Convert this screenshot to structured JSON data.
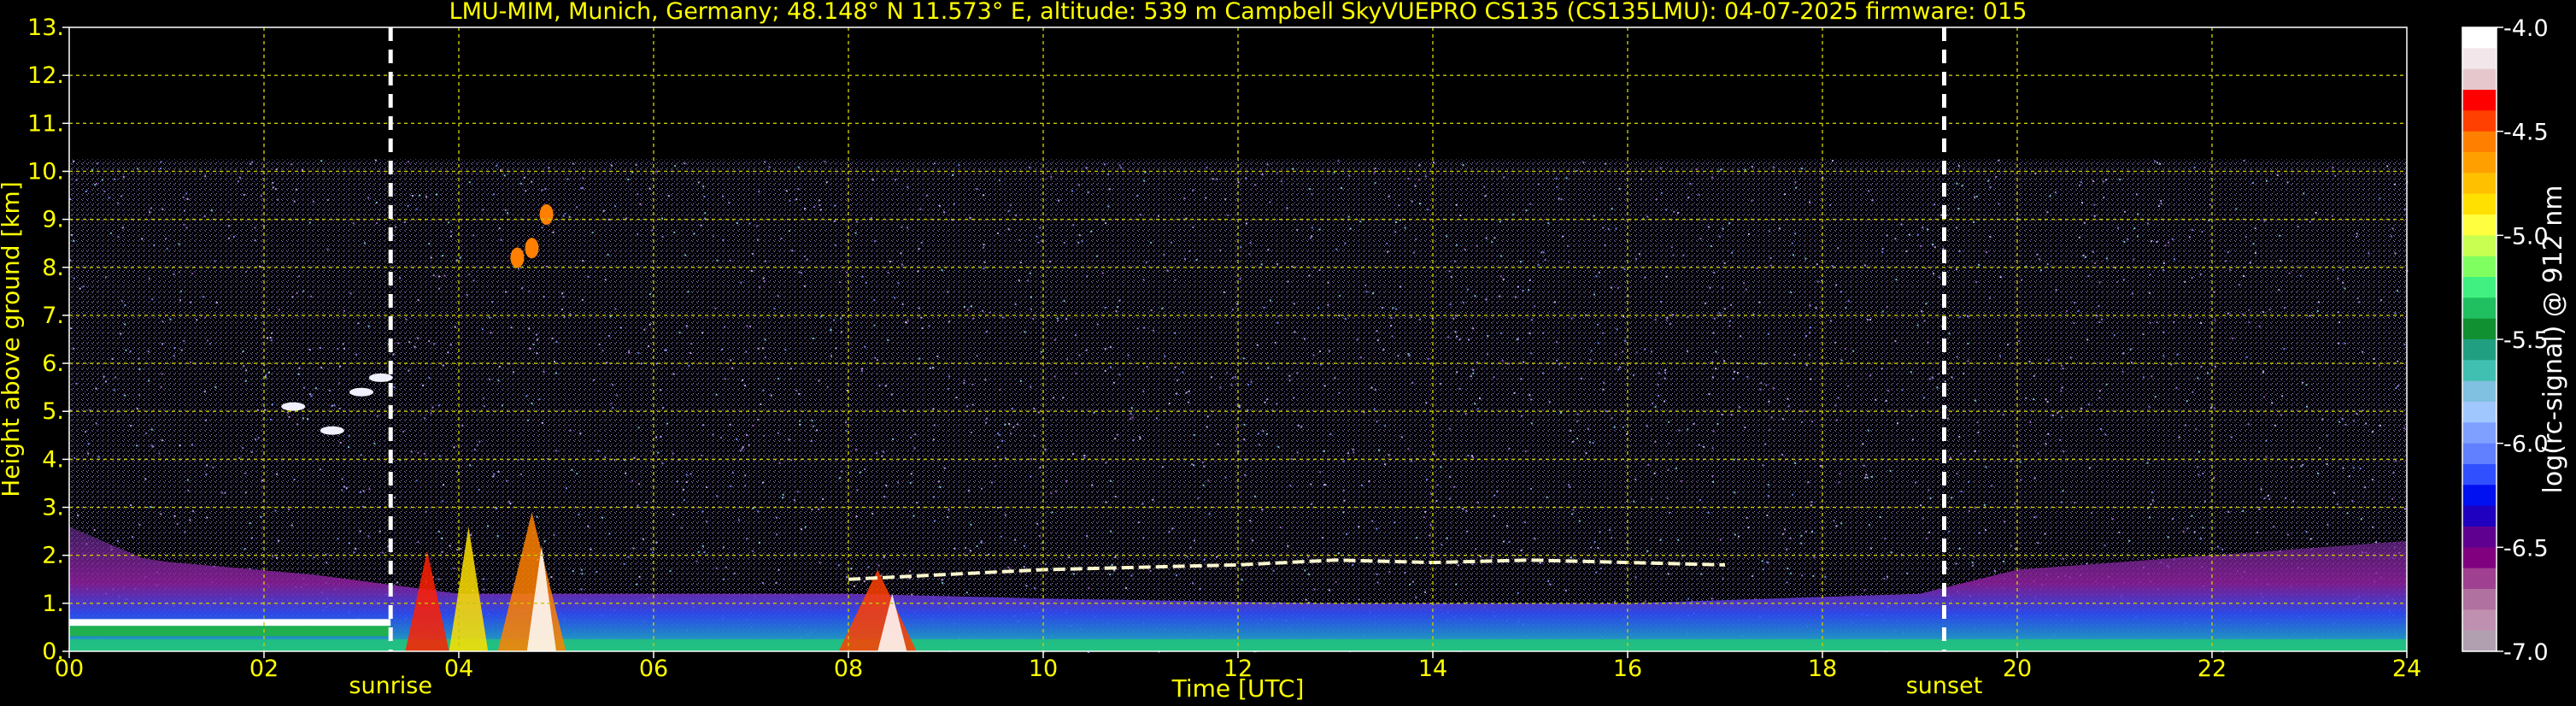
{
  "chart_data": {
    "type": "heatmap",
    "title": "LMU-MIM, Munich, Germany; 48.148° N 11.573° E, altitude: 539 m    Campbell SkyVUEPRO CS135 (CS135LMU): 04-07-2025    firmware: 015",
    "xlabel": "Time [UTC]",
    "ylabel": "Height above ground [km]",
    "xlim": [
      0,
      24
    ],
    "ylim": [
      0,
      13
    ],
    "x_ticks": [
      "00",
      "02",
      "04",
      "06",
      "08",
      "10",
      "12",
      "14",
      "16",
      "18",
      "20",
      "22",
      "24"
    ],
    "y_ticks": [
      "0.",
      "1.",
      "2.",
      "3.",
      "4.",
      "5.",
      "6.",
      "7.",
      "8.",
      "9.",
      "10.",
      "11.",
      "12.",
      "13."
    ],
    "grid": true,
    "colorbar": {
      "label": "log(rc-signal) @ 912 nm",
      "range": [
        -7.0,
        -4.0
      ],
      "ticks": [
        "-4.0",
        "-4.5",
        "-5.0",
        "-5.5",
        "-6.0",
        "-6.5",
        "-7.0"
      ],
      "colors": [
        "#ffffff",
        "#f2e6ea",
        "#e6c8cc",
        "#ff0000",
        "#ff4000",
        "#ff8000",
        "#ffa000",
        "#ffc000",
        "#ffe000",
        "#ffff40",
        "#c8ff50",
        "#80ff60",
        "#40f080",
        "#20c060",
        "#109030",
        "#20a080",
        "#40c0b0",
        "#80c0e0",
        "#a0c8ff",
        "#80a0ff",
        "#6080ff",
        "#3050ff",
        "#0010f0",
        "#2000c0",
        "#600090",
        "#800080",
        "#a04090",
        "#b070a0",
        "#c090b0",
        "#b0a0b0"
      ]
    },
    "vertical_markers": [
      {
        "label": "sunrise",
        "x": 3.3
      },
      {
        "label": "sunset",
        "x": 19.25
      }
    ],
    "layers": [
      {
        "name": "noise_top_km",
        "x": [
          0,
          24
        ],
        "y": [
          10.25,
          10.25
        ]
      },
      {
        "name": "boundary_layer_top_km",
        "x": [
          0,
          0.8,
          2.5,
          4,
          8,
          10,
          13,
          16,
          19,
          20,
          22,
          24
        ],
        "y": [
          2.6,
          1.9,
          1.6,
          1.2,
          1.2,
          1.1,
          1.0,
          1.0,
          1.2,
          1.7,
          2.0,
          2.3
        ]
      },
      {
        "name": "morning_fog_layer_km",
        "x": [
          0,
          3.3
        ],
        "y": [
          0.6,
          0.6
        ]
      },
      {
        "name": "cloud_base_km",
        "x": [
          8,
          10,
          12,
          13,
          14,
          15,
          16,
          17
        ],
        "y": [
          1.5,
          1.7,
          1.8,
          1.9,
          1.85,
          1.9,
          1.85,
          1.8
        ]
      },
      {
        "name": "morning_cloud_km",
        "x": [
          2.3,
          2.7,
          3.0,
          3.2
        ],
        "y": [
          5.1,
          4.6,
          5.4,
          5.7
        ]
      },
      {
        "name": "high_cloud_km",
        "x": [
          4.6,
          4.75,
          4.9
        ],
        "y": [
          8.2,
          8.4,
          9.1
        ]
      }
    ]
  }
}
